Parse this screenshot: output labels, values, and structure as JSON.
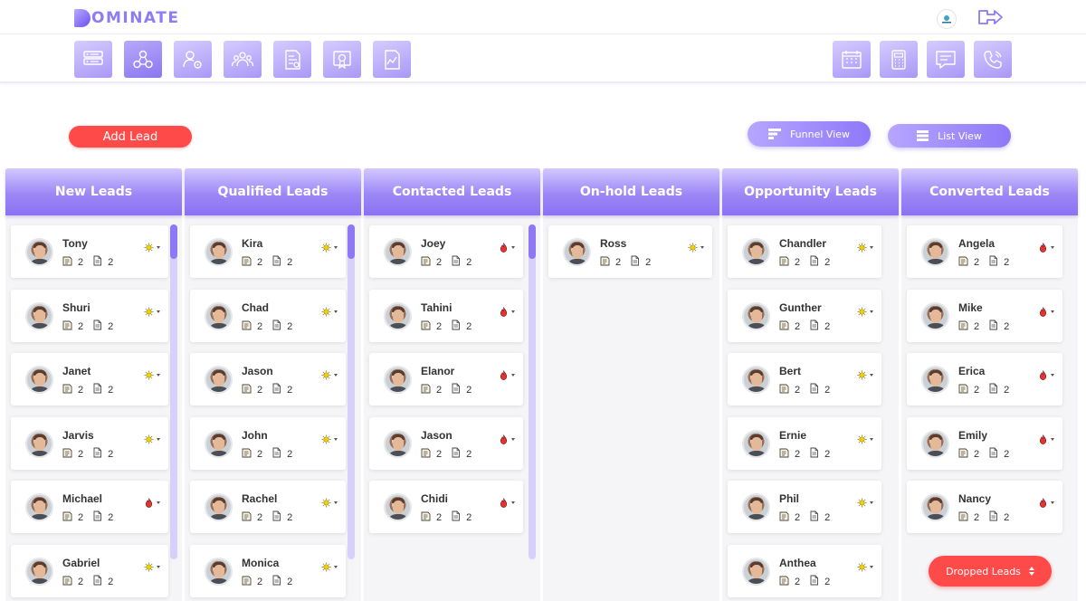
{
  "app": {
    "logo_text": "OMINATE"
  },
  "toolbar_left": [
    {
      "icon": "server-icon"
    },
    {
      "icon": "network-icon"
    },
    {
      "icon": "user-settings-icon"
    },
    {
      "icon": "team-icon"
    },
    {
      "icon": "invoice-icon"
    },
    {
      "icon": "certificate-icon"
    },
    {
      "icon": "report-icon"
    }
  ],
  "toolbar_right": [
    {
      "icon": "calendar-icon"
    },
    {
      "icon": "calculator-icon"
    },
    {
      "icon": "message-icon"
    },
    {
      "icon": "phone-icon"
    }
  ],
  "actions": {
    "add_lead": "Add Lead",
    "funnel_view": "Funnel View",
    "list_view": "List View",
    "dropped_leads": "Dropped Leads"
  },
  "colors": {
    "accent": "#8f78f6",
    "danger": "#ff4a4a",
    "status_sun": "#f2d100",
    "status_fire": "#e8322e"
  },
  "columns": [
    {
      "title": "New Leads",
      "cards": [
        {
          "name": "Tony",
          "notes": "2",
          "docs": "2",
          "status": "sun"
        },
        {
          "name": "Shuri",
          "notes": "2",
          "docs": "2",
          "status": "sun"
        },
        {
          "name": "Janet",
          "notes": "2",
          "docs": "2",
          "status": "sun"
        },
        {
          "name": "Jarvis",
          "notes": "2",
          "docs": "2",
          "status": "sun"
        },
        {
          "name": "Michael",
          "notes": "2",
          "docs": "2",
          "status": "fire"
        },
        {
          "name": "Gabriel",
          "notes": "2",
          "docs": "2",
          "status": "sun"
        }
      ]
    },
    {
      "title": "Qualified Leads",
      "cards": [
        {
          "name": "Kira",
          "notes": "2",
          "docs": "2",
          "status": "sun"
        },
        {
          "name": "Chad",
          "notes": "2",
          "docs": "2",
          "status": "sun"
        },
        {
          "name": "Jason",
          "notes": "2",
          "docs": "2",
          "status": "sun"
        },
        {
          "name": "John",
          "notes": "2",
          "docs": "2",
          "status": "sun"
        },
        {
          "name": "Rachel",
          "notes": "2",
          "docs": "2",
          "status": "sun"
        },
        {
          "name": "Monica",
          "notes": "2",
          "docs": "2",
          "status": "sun"
        }
      ]
    },
    {
      "title": "Contacted Leads",
      "cards": [
        {
          "name": "Joey",
          "notes": "2",
          "docs": "2",
          "status": "fire"
        },
        {
          "name": "Tahini",
          "notes": "2",
          "docs": "2",
          "status": "fire"
        },
        {
          "name": "Elanor",
          "notes": "2",
          "docs": "2",
          "status": "fire"
        },
        {
          "name": "Jason",
          "notes": "2",
          "docs": "2",
          "status": "fire"
        },
        {
          "name": "Chidi",
          "notes": "2",
          "docs": "2",
          "status": "fire"
        }
      ]
    },
    {
      "title": "On-hold Leads",
      "cards": [
        {
          "name": "Ross",
          "notes": "2",
          "docs": "2",
          "status": "sun"
        }
      ]
    },
    {
      "title": "Opportunity Leads",
      "cards": [
        {
          "name": "Chandler",
          "notes": "2",
          "docs": "2",
          "status": "sun"
        },
        {
          "name": "Gunther",
          "notes": "2",
          "docs": "2",
          "status": "sun"
        },
        {
          "name": "Bert",
          "notes": "2",
          "docs": "2",
          "status": "sun"
        },
        {
          "name": "Ernie",
          "notes": "2",
          "docs": "2",
          "status": "sun"
        },
        {
          "name": "Phil",
          "notes": "2",
          "docs": "2",
          "status": "sun"
        },
        {
          "name": "Anthea",
          "notes": "2",
          "docs": "2",
          "status": "sun"
        }
      ]
    },
    {
      "title": "Converted Leads",
      "cards": [
        {
          "name": "Angela",
          "notes": "2",
          "docs": "2",
          "status": "fire"
        },
        {
          "name": "Mike",
          "notes": "2",
          "docs": "2",
          "status": "fire"
        },
        {
          "name": "Erica",
          "notes": "2",
          "docs": "2",
          "status": "fire"
        },
        {
          "name": "Emily",
          "notes": "2",
          "docs": "2",
          "status": "fire"
        },
        {
          "name": "Nancy",
          "notes": "2",
          "docs": "2",
          "status": "fire"
        }
      ]
    }
  ]
}
